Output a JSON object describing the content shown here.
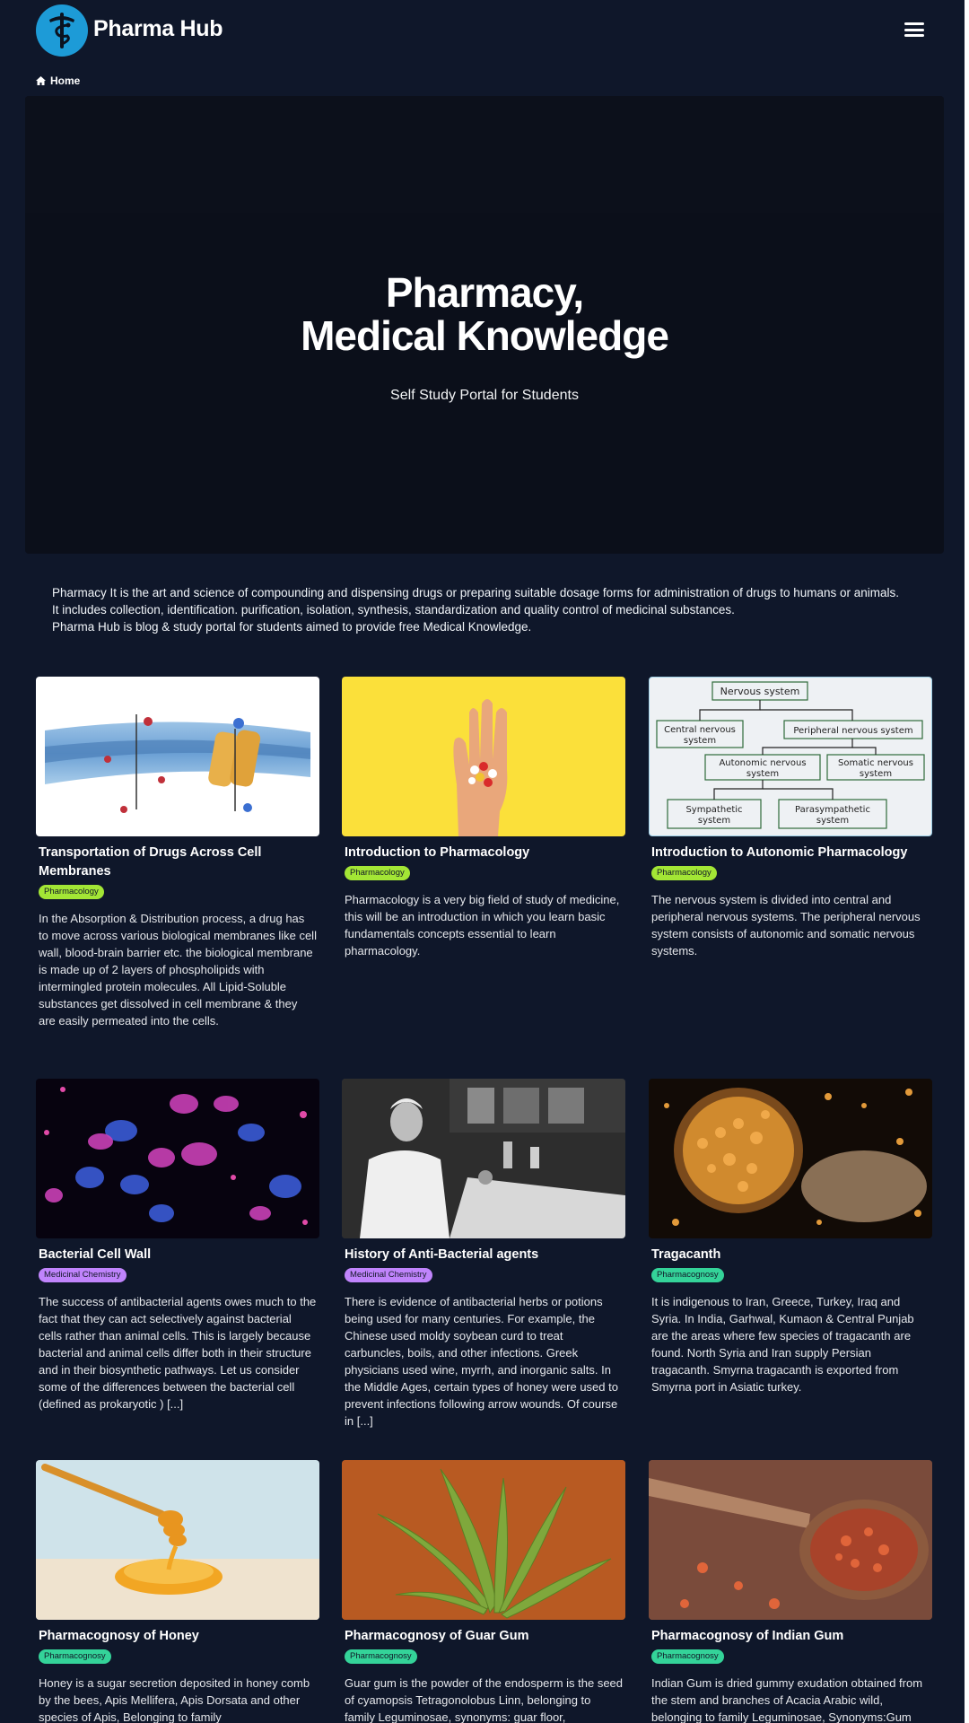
{
  "header": {
    "brand": "Pharma Hub"
  },
  "breadcrumb": {
    "label": "Home"
  },
  "hero": {
    "title_line1": "Pharmacy,",
    "title_line2": "Medical Knowledge",
    "subtitle": "Self Study Portal for Students"
  },
  "intro": {
    "line1": "Pharmacy It is the art and science of compounding and dispensing drugs or preparing suitable dosage forms for administration of drugs to humans or animals.",
    "line2": "It includes collection, identification. purification, isolation, synthesis, standardization and quality control of medicinal substances.",
    "line3": "Pharma Hub is blog & study portal for students aimed to provide free Medical Knowledge."
  },
  "cards": [
    {
      "title": "Transportation of Drugs Across Cell Membranes",
      "tag": "Pharmacology",
      "text": "In the Absorption & Distribution process, a drug has to move across various biological membranes like cell wall, blood-brain barrier etc. the biological membrane is made up of 2 layers of phospholipids with intermingled protein molecules. All Lipid-Soluble substances get dissolved in cell membrane & they are easily permeated into the cells."
    },
    {
      "title": "Introduction to Pharmacology",
      "tag": "Pharmacology",
      "text": "Pharmacology is a very big field of study of medicine, this will be an introduction in which you learn basic fundamentals concepts essential to learn pharmacology."
    },
    {
      "title": "Introduction to Autonomic Pharmacology",
      "tag": "Pharmacology",
      "text": "The nervous system is divided into central and peripheral nervous systems. The peripheral nervous system consists of autonomic and somatic nervous systems."
    },
    {
      "title": "Bacterial Cell Wall",
      "tag": "Medicinal Chemistry",
      "text": "The success of antibacterial agents owes much to the fact that they can act selectively against bacterial cells rather than animal cells. This is largely because bacterial and animal cells differ both in their structure and in their biosynthetic pathways. Let us consider some of the differences between the bacterial cell (defined as prokaryotic ) [...]"
    },
    {
      "title": "History of Anti-Bacterial agents",
      "tag": "Medicinal Chemistry",
      "text": "There is evidence of antibacterial herbs or potions being used for many centuries. For example, the Chinese used moldy soybean curd to treat carbuncles, boils, and other infections. Greek physicians used wine, myrrh, and inorganic salts. In the Middle Ages, certain types of honey were used to prevent infections following arrow wounds. Of course in [...]"
    },
    {
      "title": "Tragacanth",
      "tag": "Pharmacognosy",
      "text": "It is indigenous to Iran, Greece, Turkey, Iraq and Syria. In India, Garhwal, Kumaon & Central Punjab are the areas where few species of tragacanth are found. North Syria and Iran supply Persian tragacanth. Smyrna tragacanth is exported from Smyrna port in Asiatic turkey."
    },
    {
      "title": "Pharmacognosy of Honey",
      "tag": "Pharmacognosy",
      "text": "Honey is a sugar secretion deposited in honey comb by the bees, Apis Mellifera, Apis Dorsata and other species of Apis, Belonging to family"
    },
    {
      "title": "Pharmacognosy of Guar Gum",
      "tag": "Pharmacognosy",
      "text": "Guar gum is the powder of the endosperm is the seed of cyamopsis Tetragonolobus Linn, belonging to family Leguminosae, synonyms: guar floor,"
    },
    {
      "title": "Pharmacognosy of Indian Gum",
      "tag": "Pharmacognosy",
      "text": "Indian Gum is dried gummy exudation obtained from the stem and branches of Acacia Arabic wild, belonging to family Leguminosae, Synonyms:Gum"
    }
  ],
  "diagram": {
    "root": "Nervous system",
    "central": "Central nervous system",
    "peripheral": "Peripheral nervous system",
    "autonomic": "Autonomic nervous system",
    "somatic": "Somatic nervous system",
    "sympathetic": "Sympathetic system",
    "parasympathetic": "Parasympathetic system"
  }
}
